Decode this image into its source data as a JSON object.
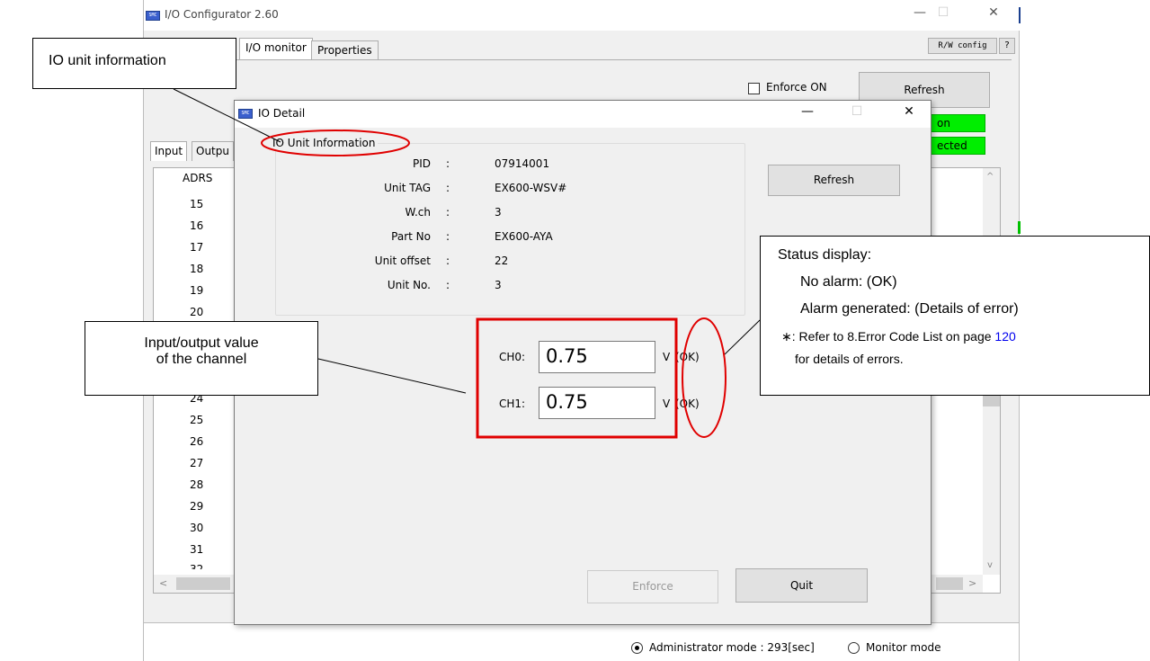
{
  "main_window": {
    "title": "I/O Configurator 2.60",
    "minimize": "—",
    "maximize": "☐",
    "close": "✕",
    "tabs": [
      "I/O monitor",
      "Properties"
    ],
    "rw_config": "R/W config",
    "help": "?",
    "enforce_on_label": "Enforce ON",
    "refresh_label": "Refresh",
    "status_1": "on",
    "status_2": "ected",
    "sub_tabs": [
      "Input",
      "Outpu"
    ],
    "column_header": "ADRS",
    "rows": [
      "15",
      "16",
      "17",
      "18",
      "19",
      "20",
      "24",
      "25",
      "26",
      "27",
      "28",
      "29",
      "30",
      "31",
      "32"
    ],
    "scroll_left": "<",
    "scroll_right": ">",
    "scroll_up": "^",
    "scroll_down": "v",
    "admin_mode": "Administrator mode : 293[sec]",
    "monitor_mode": "Monitor mode"
  },
  "dialog": {
    "title": "IO Detail",
    "minimize": "—",
    "maximize": "☐",
    "close": "✕",
    "group_title": "IO Unit Information",
    "fields": [
      {
        "label": "PID",
        "colon": ":",
        "value": "07914001"
      },
      {
        "label": "Unit TAG",
        "colon": ":",
        "value": "EX600-WSV#"
      },
      {
        "label": "W.ch",
        "colon": ":",
        "value": "3"
      },
      {
        "label": "Part No",
        "colon": ":",
        "value": "EX600-AYA"
      },
      {
        "label": "Unit offset",
        "colon": ":",
        "value": "22"
      },
      {
        "label": "Unit No.",
        "colon": ":",
        "value": "3"
      }
    ],
    "refresh_label": "Refresh",
    "channels": [
      {
        "label": "CH0:",
        "value": "0.75",
        "unit": "V",
        "status": "(OK)"
      },
      {
        "label": "CH1:",
        "value": "0.75",
        "unit": "V",
        "status": "(OK)"
      }
    ],
    "enforce_label": "Enforce",
    "quit_label": "Quit"
  },
  "annotations": {
    "io_unit_info": "IO unit information",
    "io_value_line1": "Input/output value",
    "io_value_line2": "of the channel",
    "status_title": "Status display:",
    "status_ok": "No alarm: (OK)",
    "status_alarm": "Alarm generated: (Details of error)",
    "status_note_prefix": "∗: Refer to 8.Error Code List on page ",
    "status_note_page": "120",
    "status_note_suffix": "for details of errors."
  },
  "colors": {
    "highlight_red": "#e00000",
    "status_green": "#00ee00",
    "link_blue": "#0000ee"
  }
}
